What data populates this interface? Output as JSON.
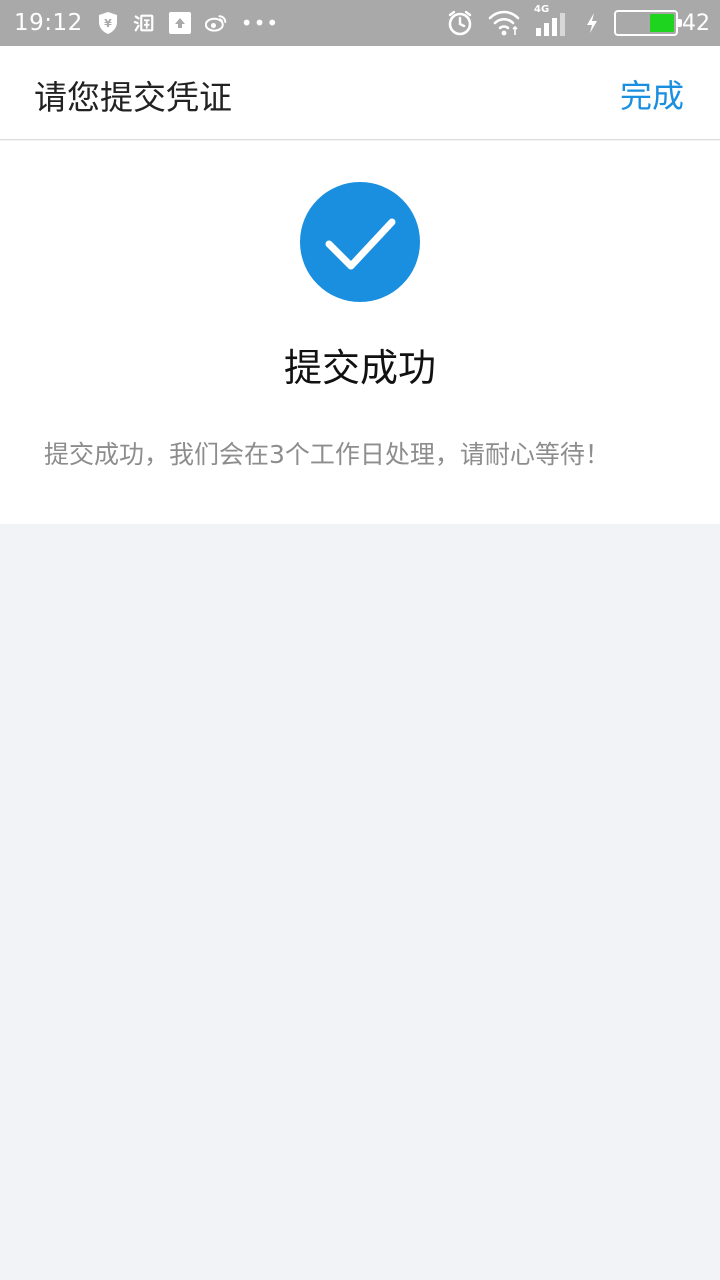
{
  "status_bar": {
    "time": "19:12",
    "more": "•••",
    "network_label": "4G",
    "battery_percent": "42",
    "battery_level": 0.42,
    "icons": [
      "shield-yen-icon",
      "taobao-icon",
      "upload-icon",
      "weibo-icon",
      "alarm-icon",
      "wifi-icon",
      "signal-icon",
      "charging-icon",
      "battery-icon"
    ]
  },
  "header": {
    "title": "请您提交凭证",
    "done_label": "完成"
  },
  "result": {
    "title": "提交成功",
    "message": "提交成功，我们会在3个工作日处理，请耐心等待！"
  },
  "colors": {
    "accent": "#1a8fe0",
    "status_bar_bg": "#a9a9a9",
    "page_bg": "#f1f3f6",
    "battery": "#1fd41f"
  }
}
